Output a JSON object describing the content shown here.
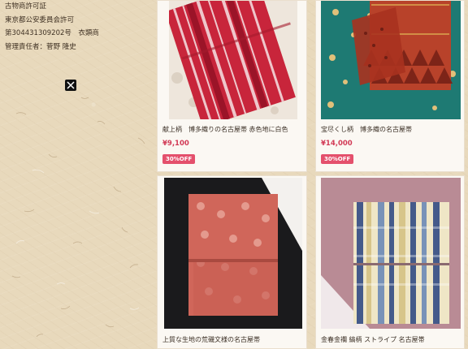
{
  "shop_info": {
    "lines": [
      "古物商許可証",
      "東京都公安委員会許可",
      "第304431309202号　衣類商",
      "管理責任者：菅野 隆史"
    ],
    "social_icon": "x-logo-icon"
  },
  "products": [
    {
      "title": "献上柄　博多織りの名古屋帯 赤色地に白色",
      "price": "¥9,100",
      "badge": "30%OFF"
    },
    {
      "title": "宝尽くし柄　博多織の名古屋帯",
      "price": "¥14,000",
      "badge": "30%OFF"
    },
    {
      "title": "上質な生地の荒磯文様の名古屋帯"
    },
    {
      "title": "金春金襴 縞柄 ストライプ 名古屋帯"
    }
  ],
  "colors": {
    "background": "#e8d9bc",
    "price": "#d23a56",
    "badge": "#e4506c",
    "card": "#fbf8f3"
  }
}
